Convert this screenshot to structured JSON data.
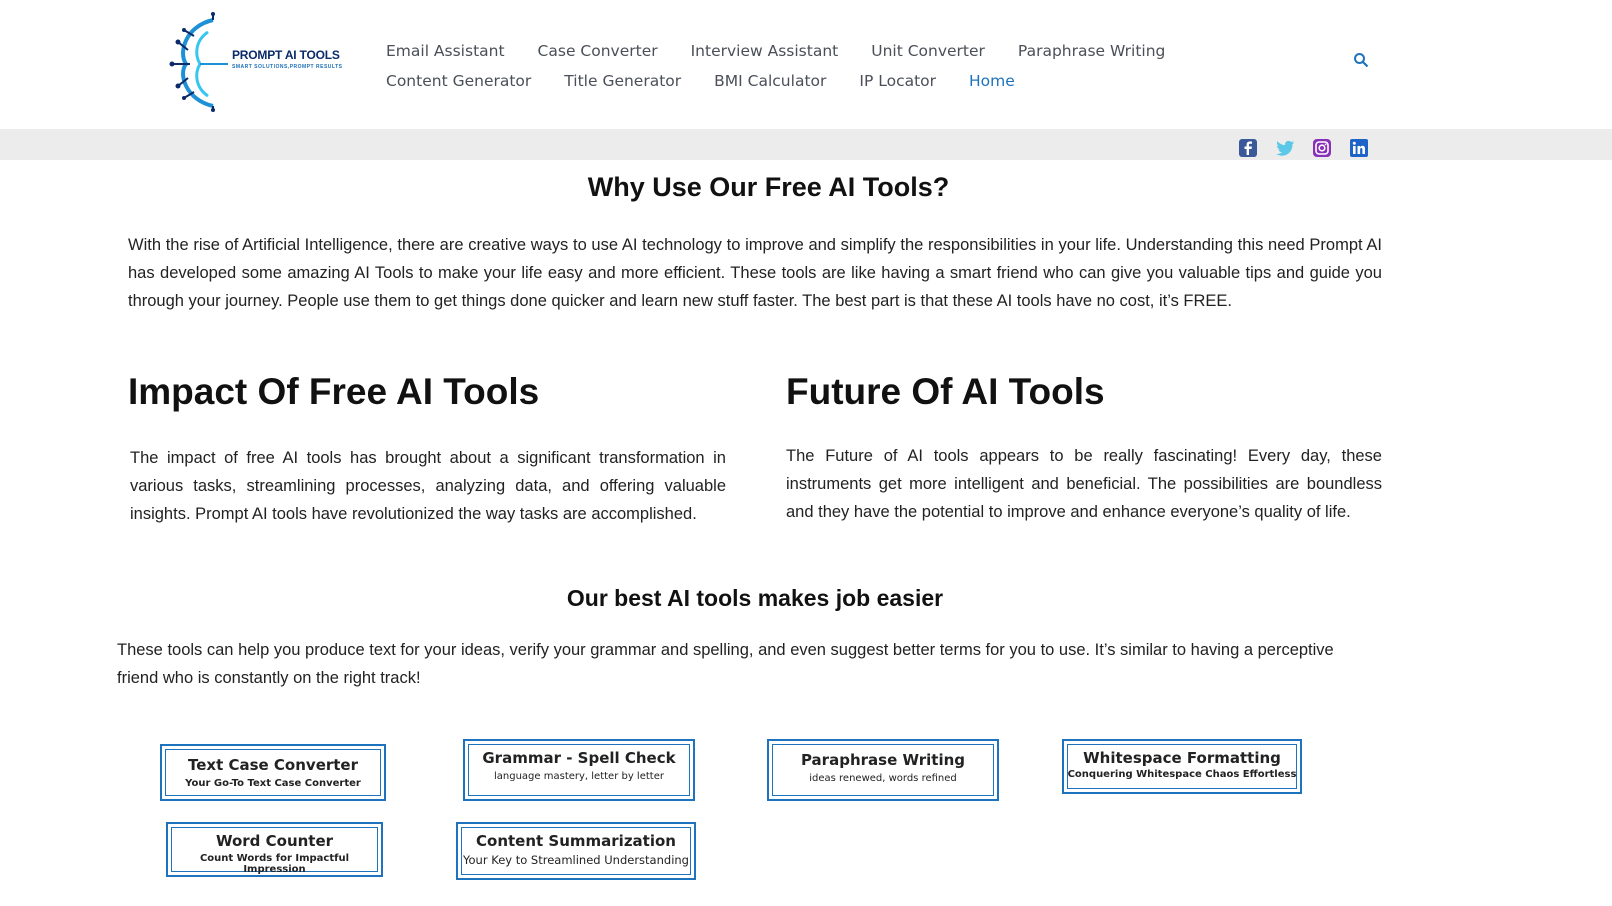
{
  "header": {
    "logo_text": "PROMPT AI TOOLS",
    "logo_tagline": "SMART SOLUTIONS,PROMPT RESULTS",
    "nav_row1": [
      "Email Assistant",
      "Case Converter",
      "Interview Assistant",
      "Unit Converter",
      "Paraphrase Writing"
    ],
    "nav_row2": [
      "Content Generator",
      "Title Generator",
      "BMI Calculator",
      "IP Locator",
      "Home"
    ],
    "active_nav": "Home",
    "accent_color": "#1e73be"
  },
  "social": [
    "facebook-icon",
    "twitter-icon",
    "instagram-icon",
    "linkedin-icon"
  ],
  "why": {
    "title": "Why Use Our Free AI Tools?",
    "text": "With the rise of Artificial Intelligence, there are creative ways to use AI technology to improve and simplify the responsibilities in your life. Understanding this need Prompt AI has developed some amazing AI Tools to make your life easy and more efficient. These tools are like having a smart friend who can give you valuable tips and guide you through your journey. People use them to get things done quicker and learn new stuff faster. The best part is that these AI tools have no cost, it’s FREE."
  },
  "impact": {
    "title": "Impact Of Free AI Tools",
    "text": "The impact of free AI tools has brought about a significant transformation in various tasks, streamlining processes, analyzing data, and offering valuable insights. Prompt AI tools have revolutionized the way tasks are accomplished."
  },
  "future": {
    "title": "Future Of AI Tools",
    "text": "The Future of AI tools appears to be really fascinating! Every day, these instruments get more intelligent and beneficial. The possibilities are boundless and they have the potential to improve and enhance everyone’s quality of life."
  },
  "best": {
    "title": "Our best AI tools makes job easier",
    "text": "These tools can help you produce text for your ideas, verify your grammar and spelling, and even suggest better terms for you to use. It’s similar to having a perceptive friend who is constantly on the right track!"
  },
  "tools": [
    {
      "name": "Text Case Converter",
      "tagline": "Your Go-To Text Case Converter"
    },
    {
      "name": "Grammar - Spell Check",
      "tagline": "language mastery, letter by letter"
    },
    {
      "name": "Paraphrase Writing",
      "tagline": "ideas renewed, words refined"
    },
    {
      "name": "Whitespace Formatting",
      "tagline": "Conquering Whitespace Chaos Effortless"
    },
    {
      "name": "Word Counter",
      "tagline": "Count Words for Impactful Impression"
    },
    {
      "name": "Content Summarization",
      "tagline": "Your Key to Streamlined Understanding"
    }
  ]
}
